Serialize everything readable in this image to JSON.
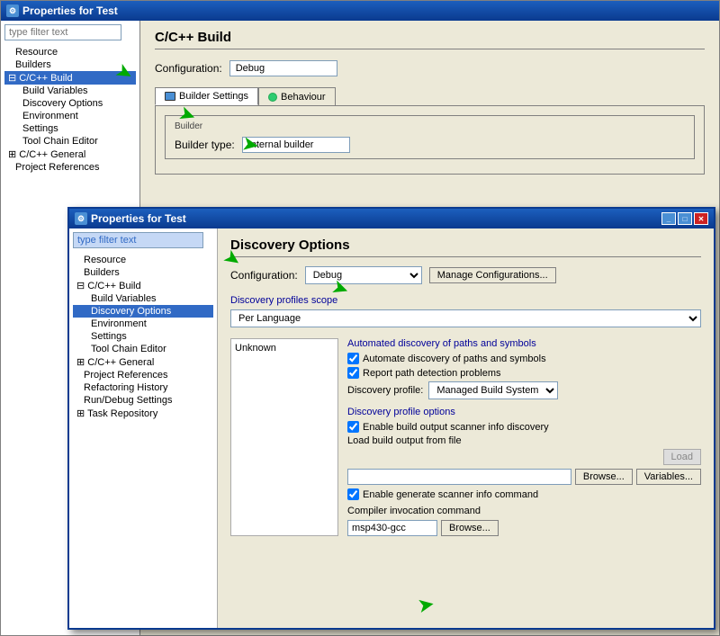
{
  "bg_window": {
    "title": "Properties for Test",
    "filter_placeholder": "type filter text",
    "left_tree": [
      {
        "label": "Resource",
        "level": 1
      },
      {
        "label": "Builders",
        "level": 1
      },
      {
        "label": "C/C++ Build",
        "level": 1,
        "selected": true,
        "expandable": true
      },
      {
        "label": "Build Variables",
        "level": 2
      },
      {
        "label": "Discovery Options",
        "level": 2
      },
      {
        "label": "Environment",
        "level": 2
      },
      {
        "label": "Settings",
        "level": 2
      },
      {
        "label": "Tool Chain Editor",
        "level": 2
      },
      {
        "label": "C/C++ General",
        "level": 1,
        "collapsible": true
      },
      {
        "label": "Project References",
        "level": 1
      }
    ],
    "main": {
      "title": "C/C++ Build",
      "config_label": "Configuration:",
      "config_value": "Debug",
      "tabs": [
        {
          "label": "Builder Settings",
          "icon": "grid",
          "active": true
        },
        {
          "label": "Behaviour",
          "icon": "circle-green"
        }
      ],
      "builder_label": "Builder",
      "builder_type_label": "Builder type:",
      "builder_type_value": "Internal builder"
    }
  },
  "fg_window": {
    "title": "Properties for Test",
    "filter_placeholder": "type filter text",
    "left_tree": [
      {
        "label": "Resource",
        "level": 1
      },
      {
        "label": "Builders",
        "level": 1
      },
      {
        "label": "C/C++ Build",
        "level": 1,
        "expandable": true
      },
      {
        "label": "Build Variables",
        "level": 2
      },
      {
        "label": "Discovery Options",
        "level": 2,
        "selected": true
      },
      {
        "label": "Environment",
        "level": 2
      },
      {
        "label": "Settings",
        "level": 2
      },
      {
        "label": "Tool Chain Editor",
        "level": 2
      },
      {
        "label": "C/C++ General",
        "level": 1,
        "collapsible": true
      },
      {
        "label": "Project References",
        "level": 1
      },
      {
        "label": "Refactoring History",
        "level": 1
      },
      {
        "label": "Run/Debug Settings",
        "level": 1
      },
      {
        "label": "Task Repository",
        "level": 1,
        "collapsible": true
      }
    ],
    "main": {
      "title": "Discovery Options",
      "config_label": "Configuration:",
      "config_value": "Debug",
      "manage_btn": "Manage Configurations...",
      "scope_section_label": "Discovery profiles scope",
      "scope_value": "Per Language",
      "unknown_label": "Unknown",
      "automated_label": "Automated discovery of paths and symbols",
      "check1": "Automate discovery of paths and symbols",
      "check2": "Report path detection problems",
      "profile_label": "Discovery profile:",
      "profile_value": "Managed Build System",
      "options_label": "Discovery profile options",
      "check3": "Enable build output scanner info discovery",
      "load_label": "Load build output from file",
      "load_btn": "Load",
      "browse_btn1": "Browse...",
      "variables_btn": "Variables...",
      "check4": "Enable generate scanner info command",
      "compiler_label": "Compiler invocation command",
      "compiler_value": "msp430-gcc",
      "browse_btn2": "Browse..."
    }
  }
}
